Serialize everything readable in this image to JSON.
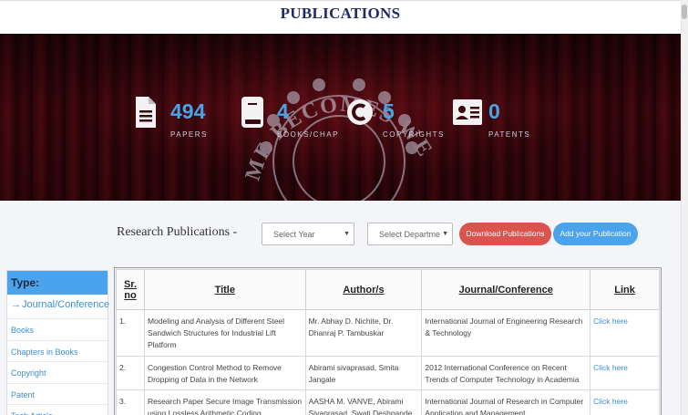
{
  "header": {
    "title": "PUBLICATIONS"
  },
  "stats": [
    {
      "icon": "document-icon",
      "value": "494",
      "label": "PAPERS"
    },
    {
      "icon": "book-icon",
      "value": "4",
      "label": "BOOKS/CHAP"
    },
    {
      "icon": "copyright-icon",
      "value": "5",
      "label": "COPYRIGHTS"
    },
    {
      "icon": "id-card-icon",
      "value": "0",
      "label": "PATENTS"
    }
  ],
  "banner": {
    "emblem_text": "ME BECOMES WE"
  },
  "toolbar": {
    "heading": "Research Publications -",
    "year_select": "Select Year",
    "department_select": "Select Departme",
    "download_label": "Download Publications",
    "add_label": "Add your Publication"
  },
  "sidebar": {
    "heading": "Type:",
    "items": [
      {
        "label": "Journal/Conference",
        "active": true
      },
      {
        "label": "Books"
      },
      {
        "label": "Chapters in Books"
      },
      {
        "label": "Copyright"
      },
      {
        "label": "Patent"
      },
      {
        "label": "Tech Article"
      }
    ]
  },
  "table": {
    "headers": [
      "Sr. no",
      "Title",
      "Author/s",
      "Journal/Conference",
      "Link"
    ],
    "rows": [
      {
        "sr": "1.",
        "title": "Modeling and Analysis of Different Steel Sandwich Structures for Industrial Lift Platform",
        "authors": "Mr. Abhay D. Nichite, Dr. Dhanraj P. Tambuskar",
        "journal": "International Journal of Engineering Research & Technology",
        "link": "Click here"
      },
      {
        "sr": "2.",
        "title": "Congestion Control Method to Remove Dropping of Data in the Network",
        "authors": "Abirami sivaprasad, Smita Jangale",
        "journal": "2012 International Conference on Recent Trends of Computer Technology in Academia",
        "link": "Click here"
      },
      {
        "sr": "3.",
        "title": "Research Paper Secure Image Transmission using Lossless Arithmetic Coding",
        "authors": "AASHA M. VANVE, Abirami Sivaprasad, Swati Deshpande",
        "journal": "International Journal of Research in Computer Application and Management",
        "link": "Click here"
      }
    ]
  },
  "colors": {
    "accent": "#4aa3ec",
    "danger": "#d9534f",
    "title": "#1f2a6b"
  }
}
